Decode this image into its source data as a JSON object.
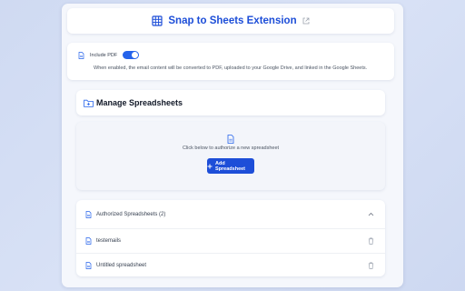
{
  "header": {
    "title": "Snap to Sheets Extension"
  },
  "pdf_setting": {
    "label": "Include PDF",
    "enabled": true,
    "description": "When enabled, the email content will be converted to PDF, uploaded to your Google Drive, and linked in the Google Sheets."
  },
  "manage": {
    "title": "Manage Spreadsheets"
  },
  "add_section": {
    "prompt": "Click below to authorize a new spreadsheet",
    "button_label": "Add Spreadsheet"
  },
  "authorized": {
    "header": "Authorized Spreadsheets (2)",
    "items": [
      {
        "name": "testemails"
      },
      {
        "name": "Untitled spreadsheet"
      }
    ]
  },
  "colors": {
    "accent": "#1d4ed8",
    "toggle": "#2563eb"
  },
  "icons": {
    "title": "table-icon",
    "external": "external-link-icon",
    "file": "file-icon",
    "folder": "folder-plus-icon",
    "plus": "plus-icon",
    "chevron": "chevron-up-icon",
    "trash": "trash-icon"
  }
}
